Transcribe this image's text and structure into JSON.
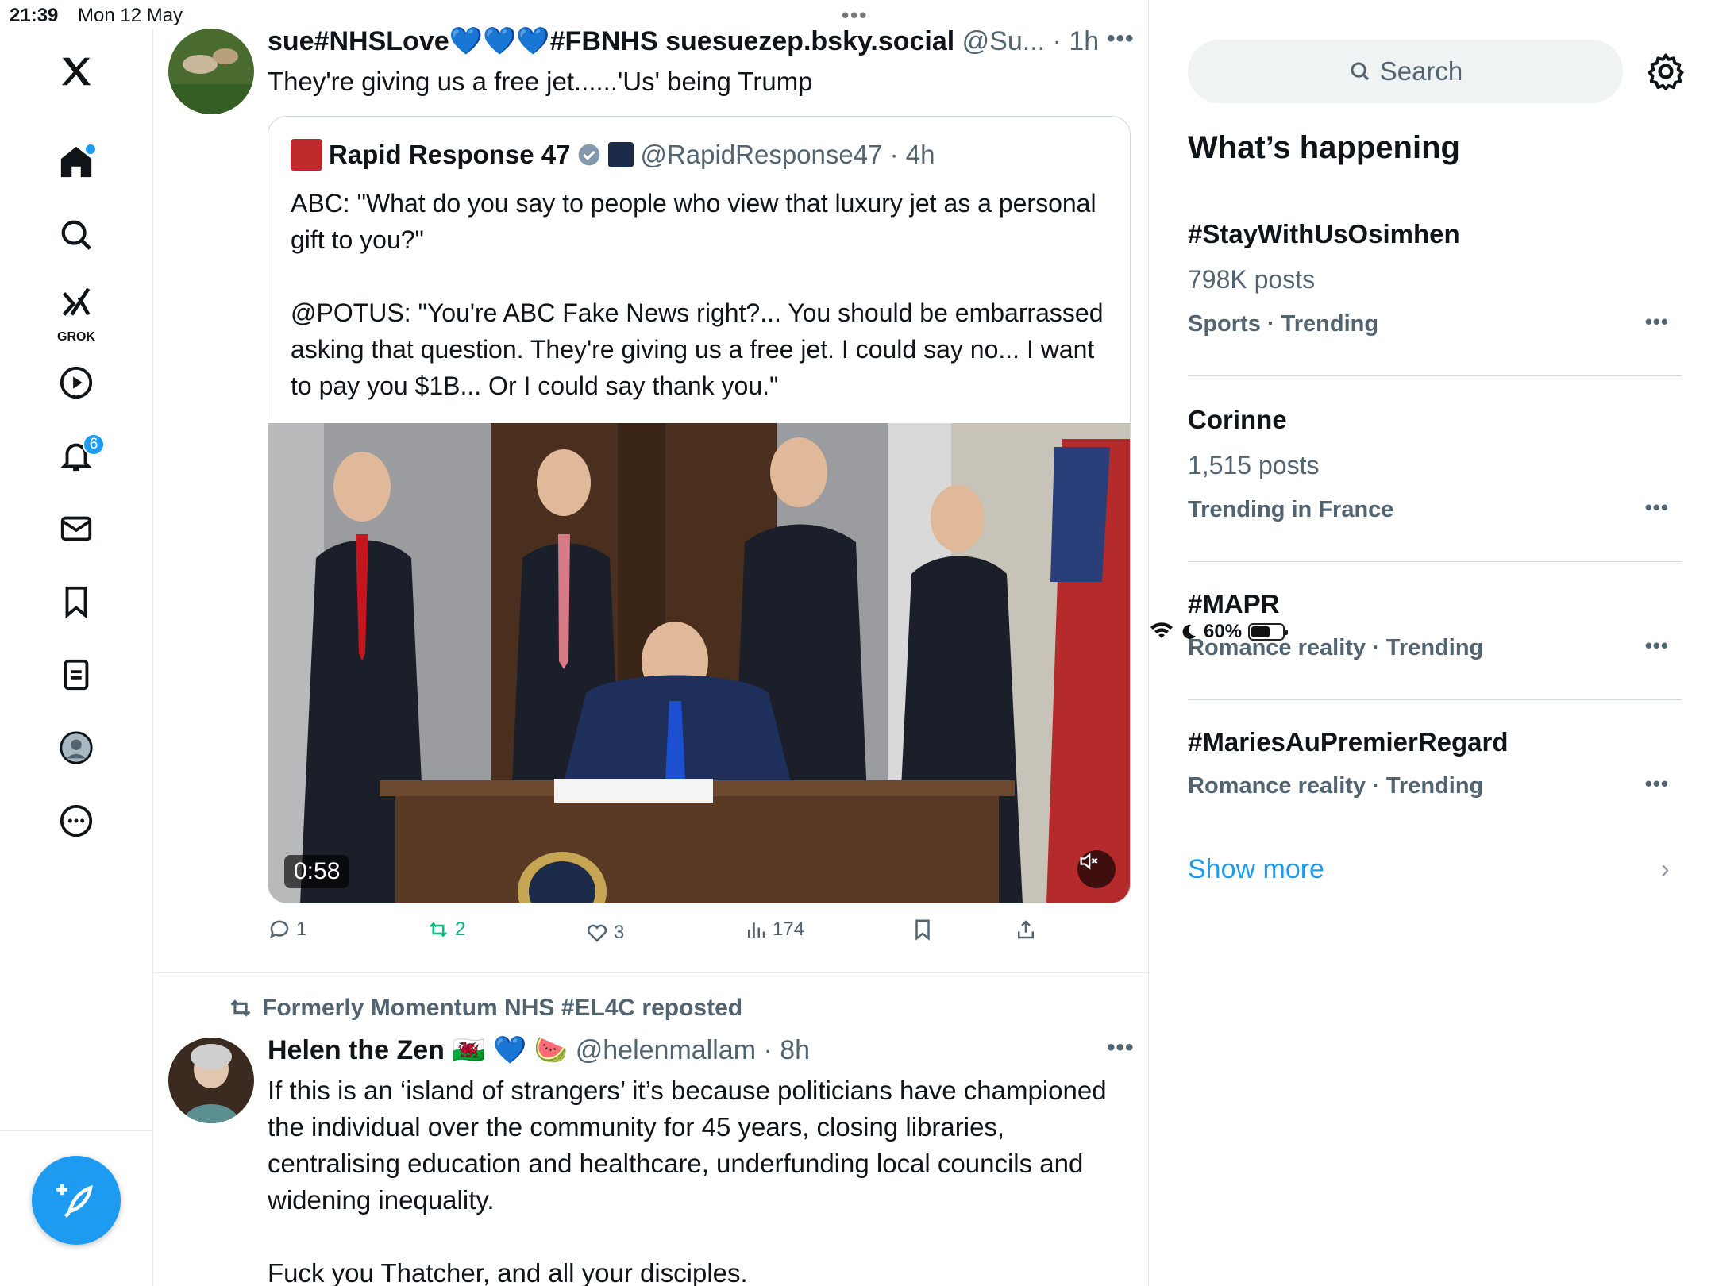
{
  "status_bar": {
    "time": "21:39",
    "date": "Mon 12 May",
    "battery": "60%"
  },
  "nav": {
    "notifications_badge": "6",
    "grok_label": "GROK"
  },
  "tweet1": {
    "name": "sue#NHSLove💙💙💙#FBNHS suesuezep.bsky.social",
    "handle": "@Su... · 1h",
    "text": "They're giving us a free jet......'Us' being Trump",
    "quote": {
      "name": "Rapid Response 47",
      "handle": "@RapidResponse47 · 4h",
      "text": "ABC: \"What do you say to people who view that luxury jet as a personal gift to you?\"\n\n@POTUS: \"You're ABC Fake News right?... You should be embarrassed asking that question. They're giving us a free jet. I could say no... I want to pay you $1B... Or I could say thank you.\"",
      "video_duration": "0:58"
    },
    "actions": {
      "replies": "1",
      "reposts": "2",
      "likes": "3",
      "views": "174"
    }
  },
  "tweet2": {
    "repost_label": "Formerly Momentum NHS #EL4C reposted",
    "name": "Helen the Zen 🏴󠁧󠁢󠁷󠁬󠁳󠁿 💙 🍉",
    "handle": "@helenmallam · 8h",
    "text": "If this is an ‘island of strangers’ it’s because politicians have championed the individual over the community for 45 years, closing libraries, centralising education and healthcare, underfunding local councils and widening inequality.\n\nFuck you Thatcher, and all your disciples."
  },
  "sidebar": {
    "search_placeholder": "Search",
    "title": "What’s happening",
    "trends": [
      {
        "name": "#StayWithUsOsimhen",
        "posts": "798K posts",
        "meta": "Sports · Trending"
      },
      {
        "name": "Corinne",
        "posts": "1,515 posts",
        "meta": "Trending in France"
      },
      {
        "name": "#MAPR",
        "posts": "",
        "meta": "Romance reality · Trending"
      },
      {
        "name": "#MariesAuPremierRegard",
        "posts": "",
        "meta": "Romance reality · Trending"
      }
    ],
    "show_more": "Show more"
  },
  "colors": {
    "accent": "#1d9bf0",
    "retweet": "#00ba7c",
    "muted": "#536471"
  }
}
